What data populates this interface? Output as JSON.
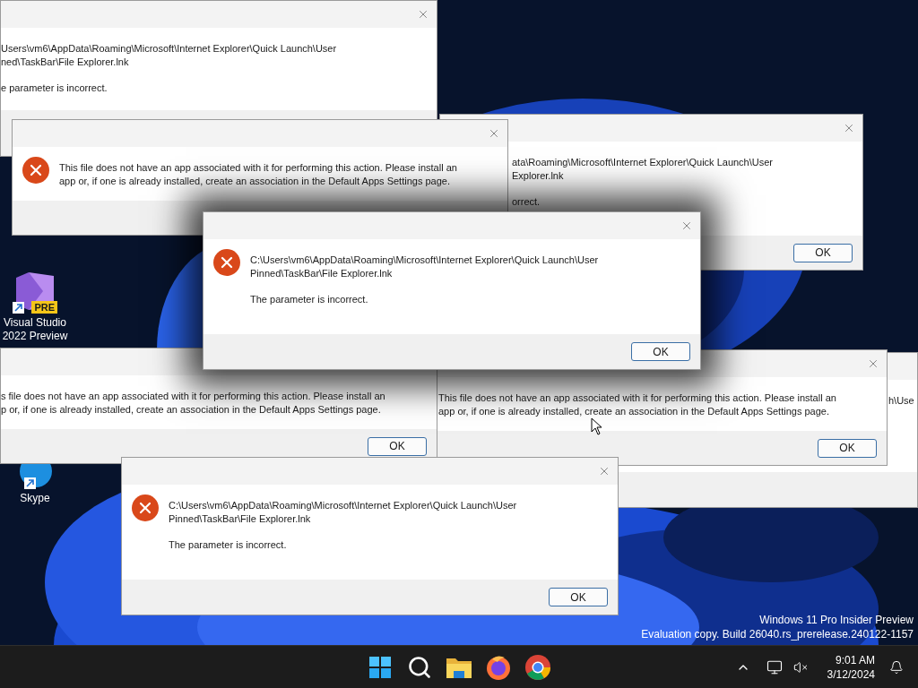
{
  "desktop_icons": [
    {
      "label": "Visual Studio 2022 Preview",
      "badge": "PRE"
    },
    {
      "label": "Skype"
    }
  ],
  "dialogs": [
    {
      "lines": [
        "Users\\vm6\\AppData\\Roaming\\Microsoft\\Internet Explorer\\Quick Launch\\User",
        "ned\\TaskBar\\File Explorer.lnk"
      ],
      "note": "e parameter is incorrect."
    },
    {
      "lines": [
        "This file does not have an app associated with it for performing this action. Please install an",
        "app or, if one is already installed, create an association in the Default Apps Settings page."
      ]
    },
    {
      "lines": [
        "ata\\Roaming\\Microsoft\\Internet Explorer\\Quick Launch\\User",
        "Explorer.lnk"
      ],
      "note": "orrect.",
      "ok_button": "OK"
    },
    {
      "lines": [
        "C:\\Users\\vm6\\AppData\\Roaming\\Microsoft\\Internet Explorer\\Quick Launch\\User",
        "Pinned\\TaskBar\\File Explorer.lnk"
      ],
      "note": "The parameter is incorrect.",
      "ok_button": "OK"
    },
    {
      "lines": [
        "s file does not have an app associated with it for performing this action. Please install an",
        "p or, if one is already installed, create an association in the Default Apps Settings page."
      ],
      "ok_button": "OK"
    },
    {
      "lines": [
        "This file does not have an app associated with it for performing this action. Please install an",
        "app or, if one is already installed, create an association in the Default Apps Settings page."
      ],
      "ok_button": "OK"
    },
    {
      "lines": [
        "h\\Use"
      ]
    },
    {
      "lines": [
        "C:\\Users\\vm6\\AppData\\Roaming\\Microsoft\\Internet Explorer\\Quick Launch\\User",
        "Pinned\\TaskBar\\File Explorer.lnk"
      ],
      "note": "The parameter is incorrect.",
      "ok_button": "OK"
    }
  ],
  "watermark": {
    "lines": [
      "Windows 11 Pro Insider Preview",
      "Evaluation copy. Build 26040.rs_prerelease.240122-1157"
    ]
  },
  "taskbar": {
    "clock": {
      "time": "9:01 AM",
      "date": "3/12/2024"
    }
  }
}
